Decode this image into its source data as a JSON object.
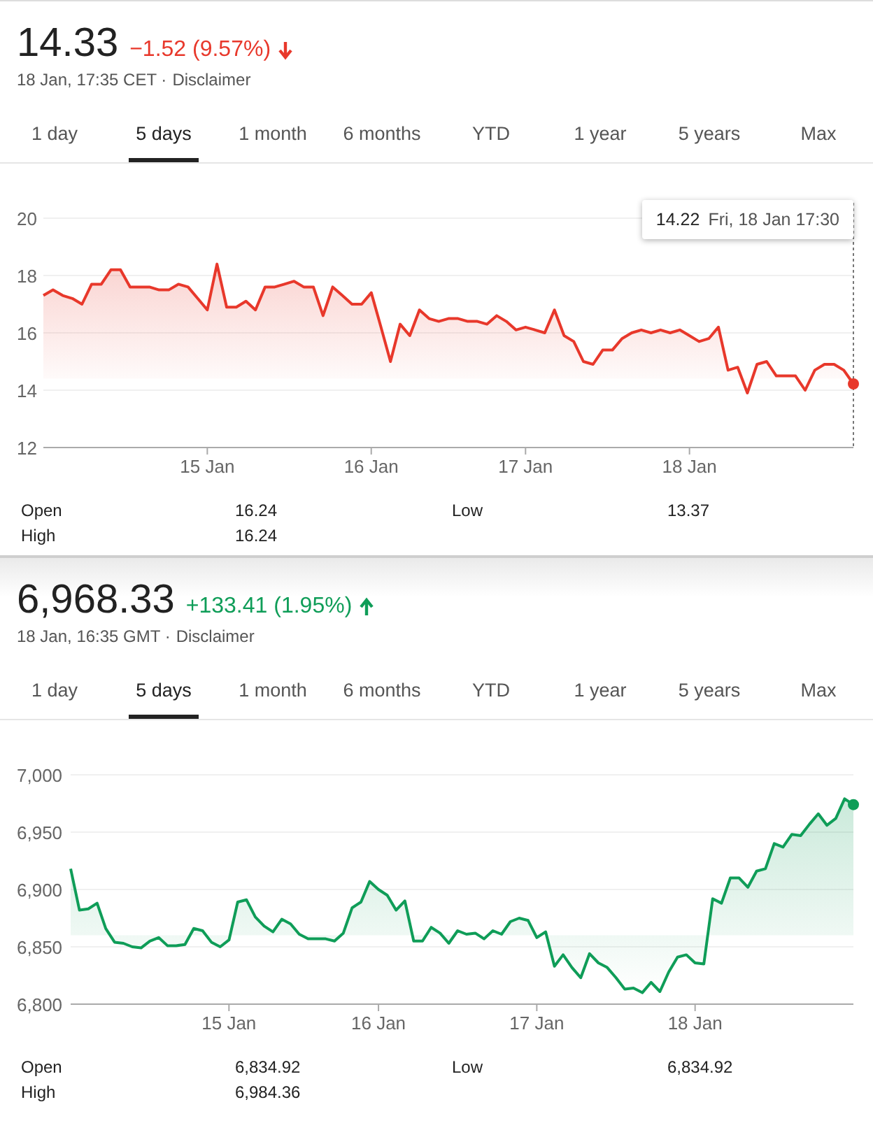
{
  "cards": [
    {
      "price": "14.33",
      "change": "−1.52 (9.57%)",
      "kind": "down",
      "time": "18 Jan, 17:35 CET ·",
      "disclaimer": "Disclaimer",
      "tabs": [
        {
          "label": "1 day",
          "selected": false
        },
        {
          "label": "5 days",
          "selected": true
        },
        {
          "label": "1 month",
          "selected": false
        },
        {
          "label": "6 months",
          "selected": false
        },
        {
          "label": "YTD",
          "selected": false
        },
        {
          "label": "1 year",
          "selected": false
        },
        {
          "label": "5 years",
          "selected": false
        },
        {
          "label": "Max",
          "selected": false
        }
      ],
      "chart": {
        "tooltip": {
          "value": "14.22",
          "date": "Fri, 18 Jan 17:30"
        },
        "chart_data": {
          "type": "area",
          "grid": true,
          "ylim": [
            12,
            20
          ],
          "categories": [
            null,
            null,
            null,
            null,
            null,
            null,
            null,
            null,
            null,
            null,
            null,
            null,
            null,
            null,
            null,
            null,
            null,
            "15 Jan",
            null,
            null,
            null,
            null,
            null,
            null,
            null,
            null,
            null,
            null,
            null,
            null,
            null,
            null,
            null,
            null,
            "16 Jan",
            null,
            null,
            null,
            null,
            null,
            null,
            null,
            null,
            null,
            null,
            null,
            null,
            null,
            null,
            null,
            "17 Jan",
            null,
            null,
            null,
            null,
            null,
            null,
            null,
            null,
            null,
            null,
            null,
            null,
            null,
            null,
            null,
            null,
            "18 Jan",
            null,
            null,
            null,
            null,
            null,
            null,
            null,
            null,
            null,
            null,
            null,
            null,
            null,
            null,
            null,
            null,
            null
          ],
          "yticks": [
            {
              "value": 12,
              "label": "12"
            },
            {
              "value": 14,
              "label": "14"
            },
            {
              "value": 16,
              "label": "16"
            },
            {
              "value": 18,
              "label": "18"
            },
            {
              "value": 20,
              "label": "20"
            }
          ],
          "series": [
            {
              "color": "#e8382b",
              "values": [
                17.3,
                17.5,
                17.3,
                17.2,
                17.0,
                17.7,
                17.7,
                18.2,
                18.2,
                17.6,
                17.6,
                17.6,
                17.5,
                17.5,
                17.7,
                17.6,
                17.2,
                16.8,
                18.4,
                16.9,
                16.9,
                17.1,
                16.8,
                17.6,
                17.6,
                17.7,
                17.8,
                17.6,
                17.6,
                16.6,
                17.6,
                17.3,
                17.0,
                17.0,
                17.4,
                16.2,
                15.0,
                16.3,
                15.9,
                16.8,
                16.5,
                16.4,
                16.5,
                16.5,
                16.4,
                16.4,
                16.3,
                16.6,
                16.4,
                16.1,
                16.2,
                16.1,
                16.0,
                16.8,
                15.9,
                15.7,
                15.0,
                14.9,
                15.4,
                15.4,
                15.8,
                16.0,
                16.1,
                16.0,
                16.1,
                16.0,
                16.1,
                15.9,
                15.7,
                15.8,
                16.2,
                14.7,
                14.8,
                13.9,
                14.9,
                15.0,
                14.5,
                14.5,
                14.5,
                14.0,
                14.7,
                14.9,
                14.9,
                14.7,
                14.22
              ]
            }
          ]
        }
      },
      "stats": [
        {
          "label": "Open",
          "value": "16.24"
        },
        {
          "label": "Low",
          "value": "13.37"
        },
        {
          "label": "High",
          "value": "16.24"
        }
      ]
    },
    {
      "price": "6,968.33",
      "change": "+133.41 (1.95%)",
      "kind": "up",
      "time": "18 Jan, 16:35 GMT ·",
      "disclaimer": "Disclaimer",
      "tabs": [
        {
          "label": "1 day",
          "selected": false
        },
        {
          "label": "5 days",
          "selected": true
        },
        {
          "label": "1 month",
          "selected": false
        },
        {
          "label": "6 months",
          "selected": false
        },
        {
          "label": "YTD",
          "selected": false
        },
        {
          "label": "1 year",
          "selected": false
        },
        {
          "label": "5 years",
          "selected": false
        },
        {
          "label": "Max",
          "selected": false
        }
      ],
      "chart": {
        "chart_data": {
          "type": "area",
          "grid": true,
          "ylim": [
            6800,
            7000
          ],
          "categories": [
            null,
            null,
            null,
            null,
            null,
            null,
            null,
            null,
            null,
            null,
            null,
            null,
            null,
            null,
            null,
            null,
            null,
            null,
            "15 Jan",
            null,
            null,
            null,
            null,
            null,
            null,
            null,
            null,
            null,
            null,
            null,
            null,
            null,
            null,
            null,
            null,
            "16 Jan",
            null,
            null,
            null,
            null,
            null,
            null,
            null,
            null,
            null,
            null,
            null,
            null,
            null,
            null,
            null,
            null,
            null,
            "17 Jan",
            null,
            null,
            null,
            null,
            null,
            null,
            null,
            null,
            null,
            null,
            null,
            null,
            null,
            null,
            null,
            null,
            null,
            "18 Jan",
            null,
            null,
            null,
            null,
            null,
            null,
            null,
            null,
            null,
            null,
            null,
            null,
            null,
            null,
            null,
            null,
            null,
            null
          ],
          "yticks": [
            {
              "value": 6800,
              "label": "6,800"
            },
            {
              "value": 6850,
              "label": "6,850"
            },
            {
              "value": 6900,
              "label": "6,900"
            },
            {
              "value": 6950,
              "label": "6,950"
            },
            {
              "value": 7000,
              "label": "7,000"
            }
          ],
          "series": [
            {
              "color": "#0f9d58",
              "values": [
                6918,
                6882,
                6883,
                6888,
                6866,
                6854,
                6853,
                6850,
                6849,
                6855,
                6858,
                6851,
                6851,
                6852,
                6866,
                6864,
                6854,
                6850,
                6856,
                6889,
                6891,
                6876,
                6868,
                6863,
                6874,
                6870,
                6861,
                6857,
                6857,
                6857,
                6855,
                6862,
                6884,
                6889,
                6907,
                6900,
                6895,
                6882,
                6890,
                6855,
                6855,
                6867,
                6862,
                6853,
                6864,
                6861,
                6862,
                6857,
                6864,
                6861,
                6872,
                6875,
                6873,
                6858,
                6863,
                6833,
                6843,
                6832,
                6823,
                6844,
                6836,
                6832,
                6823,
                6813,
                6814,
                6810,
                6819,
                6811,
                6828,
                6841,
                6843,
                6836,
                6835,
                6892,
                6888,
                6910,
                6910,
                6902,
                6916,
                6918,
                6940,
                6937,
                6948,
                6947,
                6957,
                6966,
                6956,
                6962,
                6979,
                6974
              ]
            }
          ]
        }
      },
      "stats": [
        {
          "label": "Open",
          "value": "6,834.92"
        },
        {
          "label": "Low",
          "value": "6,834.92"
        },
        {
          "label": "High",
          "value": "6,984.36"
        }
      ]
    }
  ]
}
